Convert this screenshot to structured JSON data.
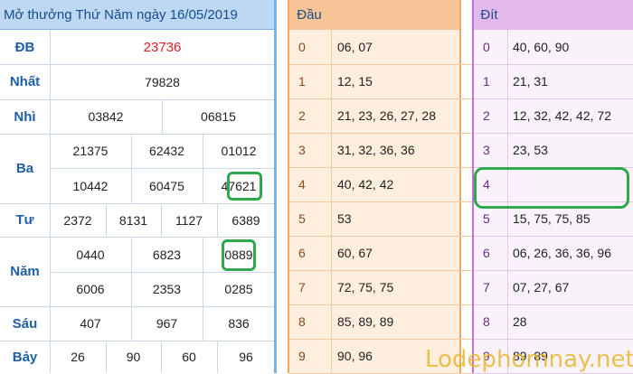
{
  "lottery": {
    "title": "Mở thưởng Thứ Năm ngày 16/05/2019",
    "rows": {
      "db": {
        "label": "ĐB",
        "values": [
          "23736"
        ]
      },
      "nhat": {
        "label": "Nhất",
        "values": [
          "79828"
        ]
      },
      "nhi": {
        "label": "Nhì",
        "values": [
          "03842",
          "06815"
        ]
      },
      "ba": {
        "label": "Ba",
        "values": [
          "21375",
          "62432",
          "01012",
          "10442",
          "60475",
          "47621"
        ]
      },
      "tu": {
        "label": "Tư",
        "values": [
          "2372",
          "8131",
          "1127",
          "6389"
        ]
      },
      "nam": {
        "label": "Năm",
        "values": [
          "0440",
          "6823",
          "0889",
          "6006",
          "2353",
          "0285"
        ]
      },
      "sau": {
        "label": "Sáu",
        "values": [
          "407",
          "967",
          "836"
        ]
      },
      "bay": {
        "label": "Bảy",
        "values": [
          "26",
          "90",
          "60",
          "96"
        ]
      }
    }
  },
  "dau": {
    "header": "Đầu",
    "rows": [
      {
        "key": "0",
        "values": "06, 07"
      },
      {
        "key": "1",
        "values": "12, 15"
      },
      {
        "key": "2",
        "values": "21, 23, 26, 27, 28"
      },
      {
        "key": "3",
        "values": "31, 32, 36, 36"
      },
      {
        "key": "4",
        "values": "40, 42, 42"
      },
      {
        "key": "5",
        "values": "53"
      },
      {
        "key": "6",
        "values": "60, 67"
      },
      {
        "key": "7",
        "values": "72, 75, 75"
      },
      {
        "key": "8",
        "values": "85, 89, 89"
      },
      {
        "key": "9",
        "values": "90, 96"
      }
    ]
  },
  "dit": {
    "header": "Đít",
    "rows": [
      {
        "key": "0",
        "values": "40, 60, 90"
      },
      {
        "key": "1",
        "values": "21, 31"
      },
      {
        "key": "2",
        "values": "12, 32, 42, 42, 72"
      },
      {
        "key": "3",
        "values": "23, 53"
      },
      {
        "key": "4",
        "values": ""
      },
      {
        "key": "5",
        "values": "15, 75, 75, 85"
      },
      {
        "key": "6",
        "values": "06, 26, 36, 36, 96"
      },
      {
        "key": "7",
        "values": "07, 27, 67"
      },
      {
        "key": "8",
        "values": "28"
      },
      {
        "key": "9",
        "values": "89, 89"
      }
    ]
  },
  "watermark": "Lodephomnay.net",
  "colors": {
    "highlight": "#2ea84a",
    "special_prize": "#e02020",
    "blue_header": "#bcd8f2",
    "orange_header": "#f7c596",
    "purple_header": "#e2b9ea"
  }
}
